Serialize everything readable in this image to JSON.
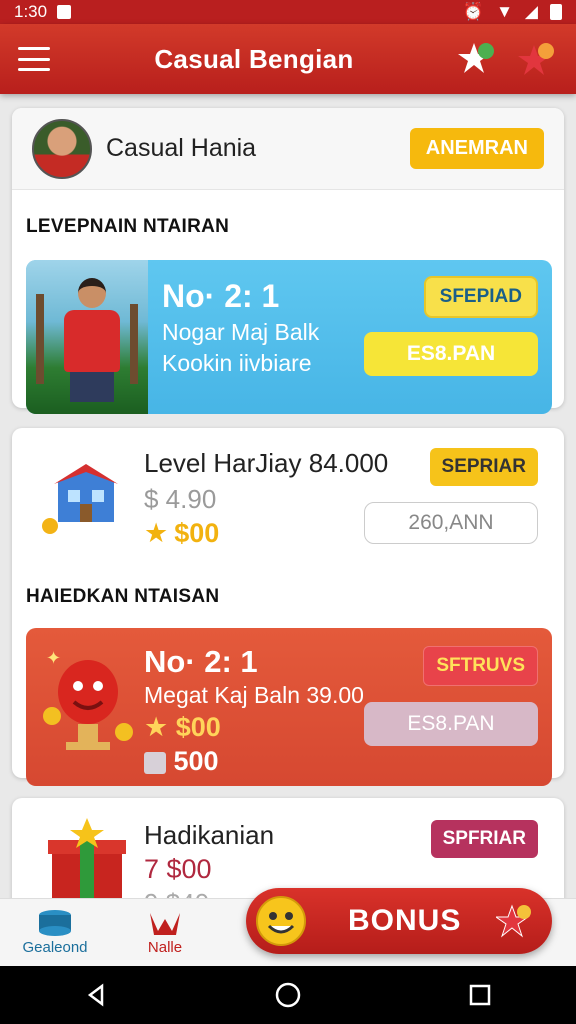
{
  "status": {
    "time": "1:30"
  },
  "appbar": {
    "title": "Casual Bengian"
  },
  "profile": {
    "name": "Casual Hania",
    "action_label": "ANEMRAN"
  },
  "sections": [
    {
      "heading": "LEVEPNAIN NTAIRAN"
    },
    {
      "heading": "HAIEDKAN NTAISAN"
    }
  ],
  "promo_blue": {
    "big": "No· 2: 1",
    "line1": "Nogar Maj Balk",
    "line2": "Kookin iivbiare",
    "tag": "SFEPIAD",
    "button": "ES8.PAN"
  },
  "item_level": {
    "title": "Level HarJiay 84.000",
    "price_old": "$ 4.90",
    "price_new": "$00",
    "tag": "SEPRIAR",
    "button": "260,ANN"
  },
  "promo_red": {
    "big": "No· 2: 1",
    "line1": "Megat Kaj Baln 39.00",
    "price": "$00",
    "count": "500",
    "tag": "SFTRUVS",
    "button": "ES8.PAN"
  },
  "item_gift": {
    "title": "Hadikanian",
    "price_new": "7 $00",
    "price_old": "9 $40",
    "tag": "SPFRIAR"
  },
  "bottom_tabs": [
    {
      "label": "Gealeond",
      "color": "#1b6f9c"
    },
    {
      "label": "Nalle",
      "color": "#c0201e"
    }
  ],
  "bonus": {
    "label": "BONUS"
  },
  "colors": {
    "primary": "#c32520",
    "accent_yellow": "#f6b90d",
    "promo_blue": "#4fbbe9",
    "promo_red": "#dd4f35"
  }
}
